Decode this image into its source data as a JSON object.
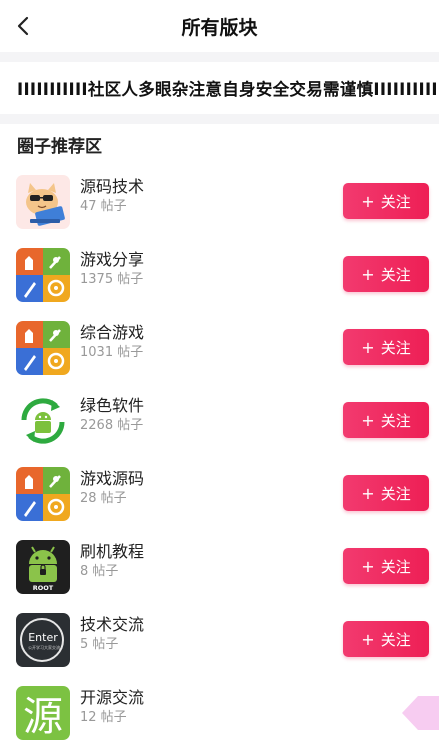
{
  "header": {
    "title": "所有版块",
    "back_icon": "back-arrow-icon"
  },
  "notice": {
    "text": "IIIIIIIIIII社区人多眼杂注意自身安全交易需谨慎IIIIIIIIIII"
  },
  "section": {
    "title": "圈子推荐区"
  },
  "colors": {
    "accent": "#ee1f55",
    "divider": "#f4f4f6"
  },
  "boards": [
    {
      "name": "源码技术",
      "count": "47 帖子",
      "icon": "cat-laptop-icon",
      "follow": "关注"
    },
    {
      "name": "游戏分享",
      "count": "1375 帖子",
      "icon": "game-center-icon",
      "follow": "关注"
    },
    {
      "name": "综合游戏",
      "count": "1031 帖子",
      "icon": "game-center-icon",
      "follow": "关注"
    },
    {
      "name": "绿色软件",
      "count": "2268 帖子",
      "icon": "android-recycle-icon",
      "follow": "关注"
    },
    {
      "name": "游戏源码",
      "count": "28 帖子",
      "icon": "game-center-icon",
      "follow": "关注"
    },
    {
      "name": "刷机教程",
      "count": "8 帖子",
      "icon": "android-root-icon",
      "follow": "关注"
    },
    {
      "name": "技术交流",
      "count": "5 帖子",
      "icon": "enter-logo-icon",
      "follow": "关注"
    },
    {
      "name": "开源交流",
      "count": "12 帖子",
      "icon": "yuan-character-icon",
      "follow": ""
    }
  ],
  "logo_text": {
    "enter": "Enter",
    "enter_sub": "公开学习大家交流",
    "root": "ROOT",
    "yuan": "源"
  },
  "plus_glyph": "+"
}
